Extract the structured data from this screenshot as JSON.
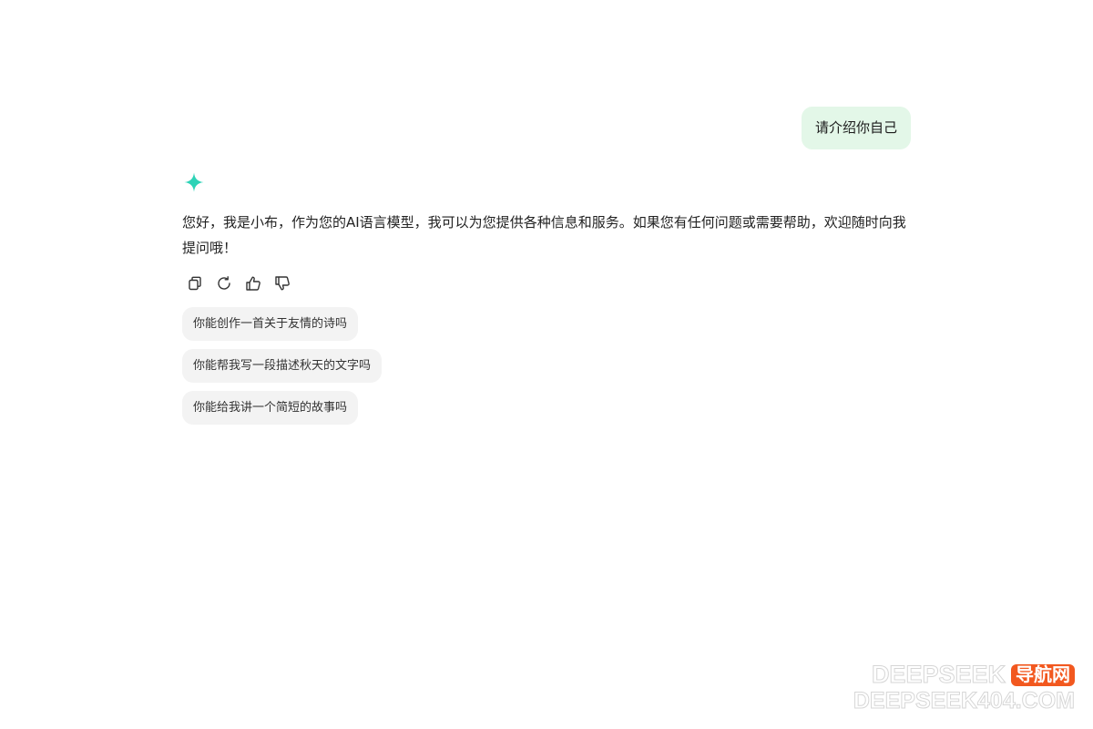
{
  "conversation": {
    "user_message": "请介绍你自己",
    "assistant": {
      "icon": "sparkle-icon",
      "accent_color": "#2ed3b7",
      "reply": "您好，我是小布，作为您的AI语言模型，我可以为您提供各种信息和服务。如果您有任何问题或需要帮助，欢迎随时向我提问哦！",
      "actions": [
        {
          "name": "copy-icon"
        },
        {
          "name": "regenerate-icon"
        },
        {
          "name": "thumbs-up-icon"
        },
        {
          "name": "thumbs-down-icon"
        }
      ]
    },
    "suggestions": [
      "你能创作一首关于友情的诗吗",
      "你能帮我写一段描述秋天的文字吗",
      "你能给我讲一个简短的故事吗"
    ]
  },
  "watermark": {
    "brand": "DEEPSEEK",
    "badge": "导航网",
    "url": "DEEPSEEK404.COM",
    "badge_color": "#f2581f"
  }
}
